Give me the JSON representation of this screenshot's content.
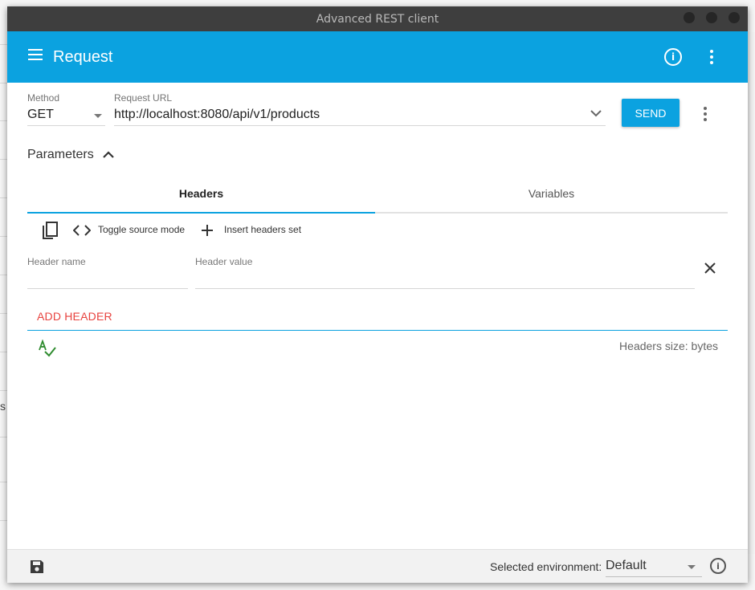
{
  "window": {
    "title": "Advanced REST client"
  },
  "appbar": {
    "title": "Request"
  },
  "request": {
    "method_label": "Method",
    "method_value": "GET",
    "url_label": "Request URL",
    "url_value": "http://localhost:8080/api/v1/products",
    "send_label": "SEND"
  },
  "parameters": {
    "label": "Parameters"
  },
  "tabs": [
    {
      "label": "Headers",
      "active": true
    },
    {
      "label": "Variables",
      "active": false
    }
  ],
  "toolbar": {
    "toggle_label": "Toggle source mode",
    "insert_label": "Insert headers set"
  },
  "header_row": {
    "name_label": "Header name",
    "value_label": "Header value",
    "name_value": "",
    "value_value": ""
  },
  "add_header_label": "ADD HEADER",
  "headers_size_label": "Headers size: bytes",
  "footer": {
    "env_label": "Selected environment:",
    "env_value": "Default"
  },
  "background": {
    "fragment": "s"
  },
  "colors": {
    "accent": "#0ba2e0",
    "add_header": "#e8433f",
    "spell_ok": "#2e8b2e"
  }
}
